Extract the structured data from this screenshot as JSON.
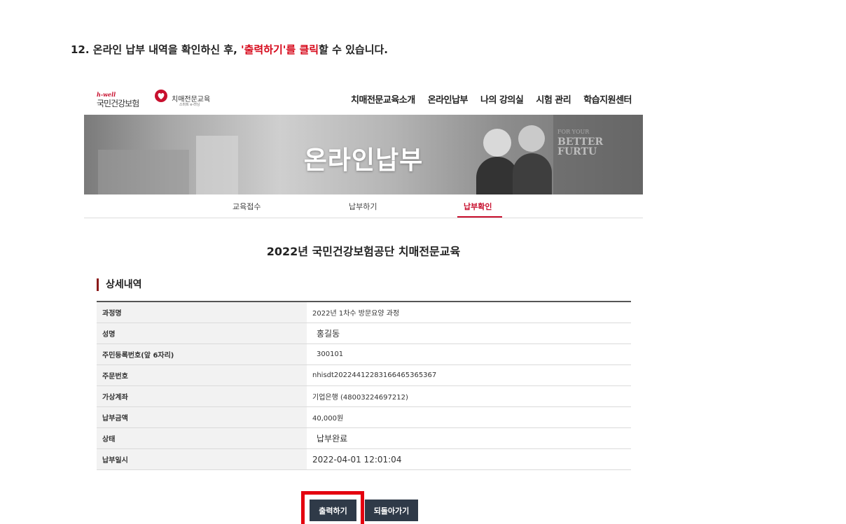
{
  "instruction": {
    "prefix": "12. 온라인 납부 내역을 확인하신 후, ",
    "highlight_1": "'출력하기'를",
    "space": " ",
    "highlight_2": "클릭",
    "suffix": "할 수 있습니다."
  },
  "header": {
    "logo_hwell": "h-well",
    "logo_nhis": "국민건강보험",
    "logo_program": "치매전문교육",
    "logo_program_sub": "스마트 e-러닝",
    "nav": [
      "치매전문교육소개",
      "온라인납부",
      "나의 강의실",
      "시험 관리",
      "학습지원센터"
    ]
  },
  "banner": {
    "title": "온라인납부",
    "bg_text_1": "FOR YOUR",
    "bg_text_2": "BETTER FURTU"
  },
  "subnav": {
    "items": [
      "교육접수",
      "납부하기",
      "납부확인"
    ],
    "active": "납부확인"
  },
  "course_title": "2022년 국민건강보험공단 치매전문교육",
  "section_title": "상세내역",
  "details": [
    {
      "label": "과정명",
      "value": "2022년 1차수 방문요양 과정"
    },
    {
      "label": "성명",
      "value": "홍길동"
    },
    {
      "label": "주민등록번호(앞 6자리)",
      "value": "300101"
    },
    {
      "label": "주문번호",
      "value": "nhisdt20224412283166465365367"
    },
    {
      "label": "가상계좌",
      "value": "기업은행 (48003224697212)"
    },
    {
      "label": "납부금액",
      "value": "40,000원"
    },
    {
      "label": "상태",
      "value": "납부완료"
    },
    {
      "label": "납부일시",
      "value": "2022-04-01 12:01:04"
    }
  ],
  "buttons": {
    "print": "출력하기",
    "back": "되돌아가기"
  },
  "colors": {
    "accent": "#c8102e",
    "highlight_box": "#e4000f",
    "button_bg": "#2f3a48"
  }
}
